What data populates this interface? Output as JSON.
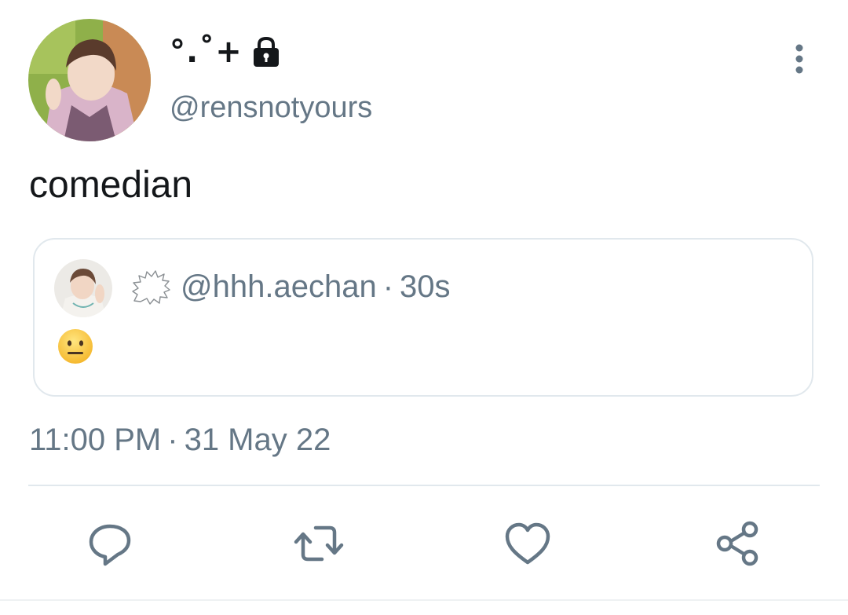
{
  "author": {
    "display_name_symbols": "°.˚+",
    "display_icon": "lock-icon",
    "handle": "@rensnotyours"
  },
  "tweet": {
    "text": "comedian",
    "time": "11:00 PM",
    "separator": "·",
    "date": "31 May 22"
  },
  "quoted": {
    "badge_icon": "speech-bubble-icon",
    "handle": "@hhh.aechan",
    "separator": "·",
    "age": "30s",
    "content_icon": "neutral-face-emoji"
  },
  "actions": [
    "reply-icon",
    "retweet-icon",
    "like-icon",
    "share-icon"
  ],
  "colors": {
    "text": "#14171a",
    "muted": "#657786",
    "border": "#e1e8ed",
    "icon": "#657786"
  }
}
